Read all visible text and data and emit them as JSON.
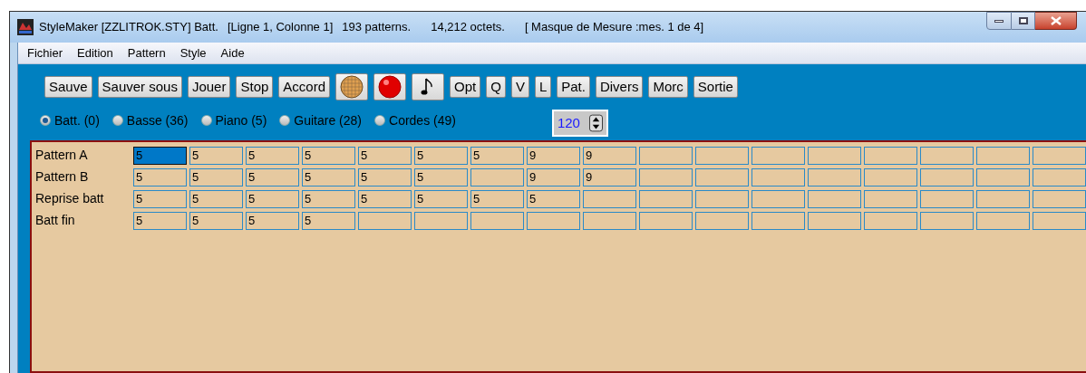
{
  "window": {
    "title_parts": [
      "StyleMaker [ZZLITROK.STY] Batt.",
      "[Ligne 1, Colonne 1]",
      "193 patterns.",
      "14,212 octets.",
      "[ Masque de Mesure :mes. 1 de 4]"
    ]
  },
  "menu": [
    "Fichier",
    "Edition",
    "Pattern",
    "Style",
    "Aide"
  ],
  "toolbar": [
    {
      "kind": "text",
      "label": "Sauve"
    },
    {
      "kind": "text",
      "label": "Sauver sous"
    },
    {
      "kind": "text",
      "label": "Jouer"
    },
    {
      "kind": "text",
      "label": "Stop"
    },
    {
      "kind": "text",
      "label": "Accord"
    },
    {
      "kind": "grid"
    },
    {
      "kind": "record"
    },
    {
      "kind": "note"
    },
    {
      "kind": "text",
      "label": "Opt"
    },
    {
      "kind": "text",
      "label": "Q"
    },
    {
      "kind": "text",
      "label": "V"
    },
    {
      "kind": "text",
      "label": "L"
    },
    {
      "kind": "text",
      "label": "Pat."
    },
    {
      "kind": "text",
      "label": "Divers"
    },
    {
      "kind": "text",
      "label": "Morc"
    },
    {
      "kind": "text",
      "label": "Sortie"
    }
  ],
  "instruments": [
    {
      "label": "Batt. (0)",
      "selected": true
    },
    {
      "label": "Basse (36)",
      "selected": false
    },
    {
      "label": "Piano (5)",
      "selected": false
    },
    {
      "label": "Guitare (28)",
      "selected": false
    },
    {
      "label": "Cordes (49)",
      "selected": false
    }
  ],
  "tempo": {
    "value": "120"
  },
  "rows": [
    {
      "label": "Pattern A",
      "cells": [
        {
          "value": "5",
          "selected": true
        },
        {
          "value": "5",
          "selected": false
        },
        {
          "value": "5",
          "selected": false
        },
        {
          "value": "5",
          "selected": false
        },
        {
          "value": "5",
          "selected": false
        },
        {
          "value": "5",
          "selected": false
        },
        {
          "value": "5",
          "selected": false
        },
        {
          "value": "9",
          "selected": false
        },
        {
          "value": "9",
          "selected": false
        },
        {
          "selected": false
        },
        {
          "selected": false
        },
        {
          "selected": false
        },
        {
          "selected": false
        },
        {
          "selected": false
        },
        {
          "selected": false
        },
        {
          "selected": false
        },
        {
          "selected": false
        }
      ]
    },
    {
      "label": "Pattern B",
      "cells": [
        {
          "value": "5",
          "selected": false
        },
        {
          "value": "5",
          "selected": false
        },
        {
          "value": "5",
          "selected": false
        },
        {
          "value": "5",
          "selected": false
        },
        {
          "value": "5",
          "selected": false
        },
        {
          "value": "5",
          "selected": false
        },
        {
          "selected": false
        },
        {
          "value": "9",
          "selected": false
        },
        {
          "value": "9",
          "selected": false
        },
        {
          "selected": false
        },
        {
          "selected": false
        },
        {
          "selected": false
        },
        {
          "selected": false
        },
        {
          "selected": false
        },
        {
          "selected": false
        },
        {
          "selected": false
        },
        {
          "selected": false
        }
      ]
    },
    {
      "label": "Reprise batt",
      "cells": [
        {
          "value": "5",
          "selected": false
        },
        {
          "value": "5",
          "selected": false
        },
        {
          "value": "5",
          "selected": false
        },
        {
          "value": "5",
          "selected": false
        },
        {
          "value": "5",
          "selected": false
        },
        {
          "value": "5",
          "selected": false
        },
        {
          "value": "5",
          "selected": false
        },
        {
          "value": "5",
          "selected": false
        },
        {
          "selected": false
        },
        {
          "selected": false
        },
        {
          "selected": false
        },
        {
          "selected": false
        },
        {
          "selected": false
        },
        {
          "selected": false
        },
        {
          "selected": false
        },
        {
          "selected": false
        },
        {
          "selected": false
        }
      ]
    },
    {
      "label": "Batt fin",
      "cells": [
        {
          "value": "5",
          "selected": false
        },
        {
          "value": "5",
          "selected": false
        },
        {
          "value": "5",
          "selected": false
        },
        {
          "value": "5",
          "selected": false
        },
        {
          "selected": false
        },
        {
          "selected": false
        },
        {
          "selected": false
        },
        {
          "selected": false
        },
        {
          "selected": false
        },
        {
          "selected": false
        },
        {
          "selected": false
        },
        {
          "selected": false
        },
        {
          "selected": false
        },
        {
          "selected": false
        },
        {
          "selected": false
        },
        {
          "selected": false
        },
        {
          "selected": false
        }
      ]
    }
  ]
}
